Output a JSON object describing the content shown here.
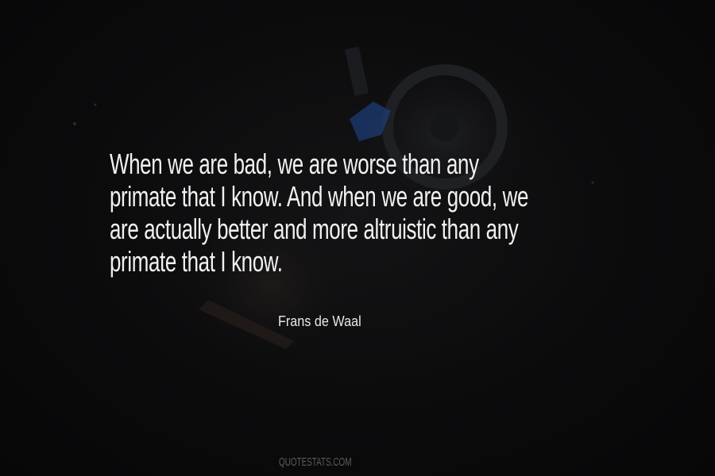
{
  "quote": {
    "lines": [
      "When we are bad, we are worse than any",
      "primate that I know. And when we are good, we",
      "are actually better and more altruistic than any",
      "primate that I know."
    ]
  },
  "author": "Frans de Waal",
  "watermark": "QUOTESTATS.COM",
  "background": {
    "description_icon": "dark-gym-photo",
    "colors": {
      "base": "#0a0a0b",
      "text": "#f1f1f1",
      "watermark": "#5c5c5f",
      "accent_blue": "#2a5db8"
    }
  }
}
